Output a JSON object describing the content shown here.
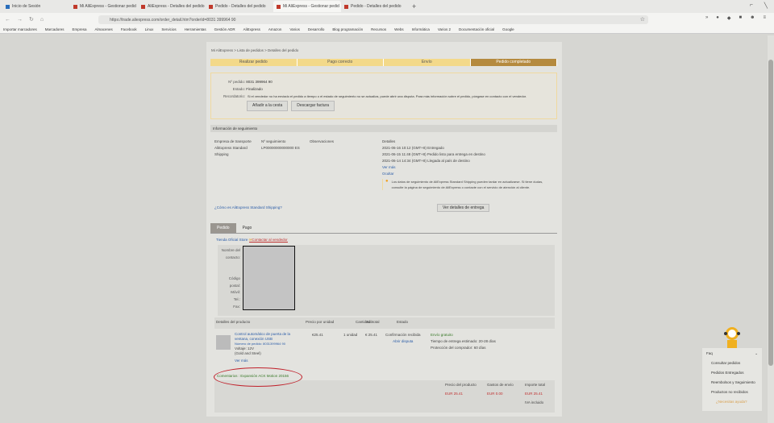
{
  "browser": {
    "tabs": [
      {
        "title": "Inicio de Sesión",
        "active": false
      },
      {
        "title": "Mi AliExpress - Gestionar pedid",
        "active": false
      },
      {
        "title": "AliExpress - Detalles del pedido",
        "active": false
      },
      {
        "title": "Pedido - Detalles del pedido",
        "active": false
      },
      {
        "title": "Mi AliExpress - Gestionar pedid",
        "active": true
      },
      {
        "title": "Pedido - Detalles del pedido",
        "active": false
      }
    ],
    "url": "https://trade.aliexpress.com/order_detail.htm?orderId=8031 399964 90",
    "bookmarks": [
      "Importar marcadores",
      "Marcadores",
      "Empresa",
      "Almacenes",
      "Facebook",
      "Linux",
      "Servicios",
      "Herramientas",
      "Gestión ADR",
      "AliExpress",
      "Amazon",
      "Varios",
      "Desarrollo",
      "Blog programación",
      "Recursos",
      "Webs",
      "Informática",
      "Varios 2",
      "Documentación oficial",
      "Google"
    ]
  },
  "breadcrumb": "Mi AliExpress > Lista de pedidos > Detalles del pedido",
  "steps": [
    {
      "label": "Realizar pedido",
      "done": false
    },
    {
      "label": "Pago correcto",
      "done": false
    },
    {
      "label": "Envío",
      "done": false
    },
    {
      "label": "Pedido completado",
      "done": true
    }
  ],
  "summary": {
    "order_no_label": "Nº pedido:",
    "order_no": "8031 399964 90",
    "status_label": "Estado:",
    "status": "Finalizado",
    "note_label": "Recordatorio:",
    "note": "Si el vendedor no ha enviado el pedido a tiempo o el estado de seguimiento no se actualiza, puede abrir una disputa. Para más información sobre el pedido, póngase en contacto con el vendedor.",
    "buttons": [
      "Añadir a la cesta",
      "Descargar factura"
    ]
  },
  "tracking": {
    "title": "Información de seguimiento",
    "headers": [
      "Empresa de transporte",
      "Nº seguimiento",
      "Observaciones",
      "Detalles"
    ],
    "carrier": "AliExpress Standard Shipping",
    "tracking_no": "LP00000000000000 ES",
    "events": [
      "2021-06-16 10:12 (GMT+8) Entregado",
      "2021-06-15 11:48 (GMT+8) Pedido listo para entrega en destino",
      "2021-06-14 14:34 (GMT+8) Llegada al país de destino"
    ],
    "links": [
      "Ver más",
      "Ocultar"
    ],
    "notice": "Los datos de seguimiento de AliExpress Standard Shipping pueden tardar en actualizarse. Si tiene dudas, consulte la página de seguimiento de AliExpress o contacte con el servicio de atención al cliente.",
    "footer_link": "¿Cómo es AliExpress Standard Shipping?",
    "delivery_button": "Ver detalles de entrega"
  },
  "tabs": [
    "Pedido",
    "Pago"
  ],
  "store": {
    "name": "Tienda Oficial Store",
    "contact": "Contactar al vendedor"
  },
  "address_labels": [
    "Nombre del",
    "contacto:",
    "",
    "",
    "Código",
    "postal:",
    "Móvil:",
    "Tel.:",
    "Fax:"
  ],
  "items": {
    "headers": [
      "Detalles del producto",
      "Precio por unidad",
      "Cantidad",
      "Subtotal",
      "Estado"
    ],
    "row": {
      "title": "Control automático de puerta de la ventana, conexión USB",
      "sku": "Número de pedido: 8031399964 90",
      "variant": "Voltaje: 12V",
      "variant2": "(Gold and Steel)",
      "price": "€25.41",
      "qty": "1 unidad",
      "subtotal": "€ 25.41",
      "status": "Confirmación recibida",
      "status_link": "Abrir disputa",
      "shipping": "Envío gratuito",
      "delivery": "Tiempo de entrega estimado: 20-28 días",
      "protection": "Protección del comprador: 60 días",
      "link": "Ver más"
    },
    "comment": "Comentarios : Expansión ACK Motion 20156"
  },
  "totals": {
    "headers": [
      "Precio del producto",
      "Gastos de envío",
      "Importe total"
    ],
    "values": [
      "EUR 25.41",
      "EUR 0.00",
      "EUR 25.41"
    ],
    "vat": "IVA incluido"
  },
  "help": {
    "title": "Faq",
    "items": [
      "Consultar pedidos",
      "Pedidos Entregados",
      "Reembolsos y Seguimiento",
      "Productos no recibidos"
    ],
    "link": "¿Necesitas ayuda?"
  }
}
